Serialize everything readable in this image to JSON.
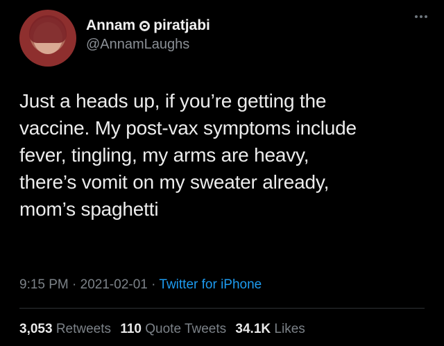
{
  "user": {
    "name_first": "Annam",
    "name_second": "piratjabi",
    "handle": "@AnnamLaughs",
    "name_emoji_icon": "smiley-emoji-icon"
  },
  "tweet": {
    "text": "Just a heads up, if you’re getting the\nvaccine. My post-vax symptoms include\nfever, tingling, my arms are heavy,\nthere’s vomit on my sweater already,\nmom’s spaghetti",
    "time": "9:15 PM",
    "date": "2021-02-01",
    "separator": "·",
    "source": "Twitter for iPhone"
  },
  "stats": {
    "retweets_count": "3,053",
    "retweets_label": "Retweets",
    "quote_count": "110",
    "quote_label": "Quote Tweets",
    "likes_count": "34.1K",
    "likes_label": "Likes"
  },
  "colors": {
    "background": "#000000",
    "link": "#1d9bf0",
    "muted": "#7c8288"
  }
}
